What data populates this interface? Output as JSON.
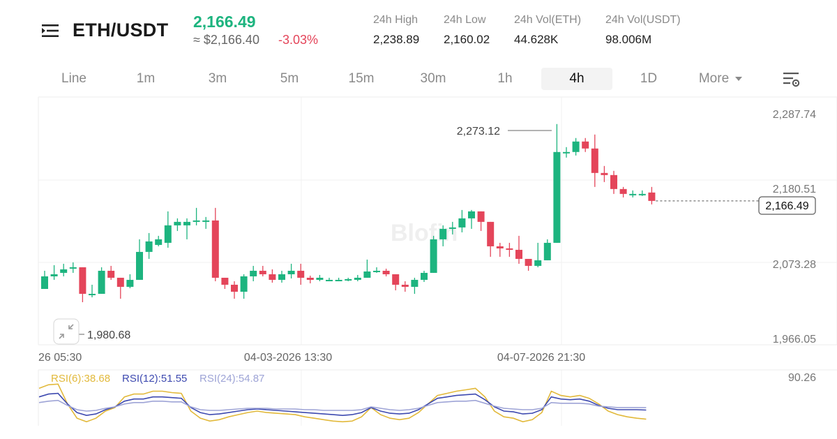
{
  "header": {
    "pair": "ETH/USDT",
    "last_price": "2,166.49",
    "approx_price": "≈ $2,166.40",
    "change": "-3.03%",
    "stats": [
      {
        "label": "24h High",
        "value": "2,238.89"
      },
      {
        "label": "24h Low",
        "value": "2,160.02"
      },
      {
        "label": "24h Vol(ETH)",
        "value": "44.628K"
      },
      {
        "label": "24h Vol(USDT)",
        "value": "98.006M"
      }
    ]
  },
  "tabs": [
    "Line",
    "1m",
    "3m",
    "5m",
    "15m",
    "30m",
    "1h",
    "4h",
    "1D",
    "More"
  ],
  "active_tab": "4h",
  "icons": {
    "menu": "menu-icon",
    "settings": "chart-settings-icon",
    "collapse": "collapse-arrows-icon"
  },
  "colors": {
    "up": "#1db47f",
    "down": "#e4455a",
    "rsi6": "#e2b93b",
    "rsi12": "#3e4ab0",
    "rsi24": "#9ea4d6"
  },
  "chart_data": [
    {
      "type": "candlestick",
      "y_axis_labels": [
        "2,287.74",
        "2,180.51",
        "2,073.28",
        "1,966.05"
      ],
      "y_axis_values": [
        2287.74,
        2180.51,
        2073.28,
        1966.05
      ],
      "x_axis_labels": [
        "26 05:30",
        "04-03-2026 13:30",
        "04-07-2026 21:30"
      ],
      "current_price_label": "2,166.49",
      "high_marker": "2,273.12",
      "low_marker": "1,980.68",
      "watermark": "Blofin",
      "candles": [
        [
          2037,
          2055,
          2063,
          2037
        ],
        [
          2055,
          2058,
          2071,
          2050
        ],
        [
          2060,
          2065,
          2073,
          2055
        ],
        [
          2068,
          2068,
          2075,
          2060
        ],
        [
          2068,
          2030,
          2068,
          2018
        ],
        [
          2030,
          2030,
          2043,
          2025
        ],
        [
          2030,
          2063,
          2068,
          2030
        ],
        [
          2063,
          2053,
          2070,
          2050
        ],
        [
          2053,
          2040,
          2053,
          2023
        ],
        [
          2040,
          2050,
          2058,
          2038
        ],
        [
          2050,
          2090,
          2108,
          2050
        ],
        [
          2090,
          2105,
          2117,
          2080
        ],
        [
          2100,
          2108,
          2113,
          2098
        ],
        [
          2103,
          2128,
          2148,
          2096
        ],
        [
          2128,
          2133,
          2138,
          2120
        ],
        [
          2128,
          2133,
          2138,
          2108
        ],
        [
          2133,
          2135,
          2153,
          2128
        ],
        [
          2135,
          2135,
          2140,
          2123
        ],
        [
          2135,
          2053,
          2153,
          2048
        ],
        [
          2053,
          2043,
          2053,
          2037
        ],
        [
          2043,
          2033,
          2048,
          2023
        ],
        [
          2033,
          2055,
          2058,
          2023
        ],
        [
          2055,
          2063,
          2070,
          2048
        ],
        [
          2063,
          2058,
          2070,
          2055
        ],
        [
          2058,
          2050,
          2065,
          2046
        ],
        [
          2050,
          2058,
          2063,
          2046
        ],
        [
          2058,
          2063,
          2073,
          2052
        ],
        [
          2063,
          2053,
          2073,
          2043
        ],
        [
          2053,
          2050,
          2056,
          2045
        ],
        [
          2050,
          2053,
          2057,
          2048
        ],
        [
          2050,
          2050,
          2053,
          2048
        ],
        [
          2050,
          2050,
          2053,
          2048
        ],
        [
          2050,
          2051,
          2053,
          2048
        ],
        [
          2050,
          2053,
          2057,
          2048
        ],
        [
          2053,
          2062,
          2079,
          2053
        ],
        [
          2062,
          2063,
          2068,
          2060
        ],
        [
          2063,
          2058,
          2066,
          2055
        ],
        [
          2058,
          2043,
          2058,
          2035
        ],
        [
          2043,
          2040,
          2048,
          2033
        ],
        [
          2040,
          2050,
          2053,
          2030
        ],
        [
          2050,
          2060,
          2063,
          2047
        ],
        [
          2060,
          2108,
          2113,
          2060
        ],
        [
          2108,
          2123,
          2128,
          2098
        ],
        [
          2123,
          2125,
          2133,
          2115
        ],
        [
          2125,
          2138,
          2150,
          2118
        ],
        [
          2138,
          2148,
          2150,
          2123
        ],
        [
          2148,
          2133,
          2148,
          2120
        ],
        [
          2133,
          2098,
          2133,
          2083
        ],
        [
          2098,
          2095,
          2103,
          2083
        ],
        [
          2095,
          2093,
          2103,
          2083
        ],
        [
          2093,
          2080,
          2113,
          2073
        ],
        [
          2080,
          2070,
          2078,
          2063
        ],
        [
          2070,
          2078,
          2103,
          2068
        ],
        [
          2078,
          2103,
          2108,
          2078
        ],
        [
          2103,
          2233,
          2273,
          2103
        ],
        [
          2233,
          2233,
          2240,
          2225
        ],
        [
          2233,
          2248,
          2253,
          2228
        ],
        [
          2248,
          2238,
          2253,
          2233
        ],
        [
          2238,
          2203,
          2258,
          2183
        ],
        [
          2203,
          2200,
          2213,
          2190
        ],
        [
          2200,
          2180,
          2206,
          2173
        ],
        [
          2180,
          2173,
          2183,
          2168
        ],
        [
          2173,
          2173,
          2178,
          2168
        ],
        [
          2173,
          2173,
          2178,
          2170
        ],
        [
          2175,
          2163,
          2183,
          2158
        ]
      ]
    },
    {
      "type": "line",
      "title": "RSI",
      "y_label": "90.26",
      "series": [
        {
          "name": "RSI(6)",
          "label": "RSI(6):38.68",
          "values": [
            82,
            87,
            88,
            60,
            40,
            35,
            40,
            50,
            55,
            70,
            74,
            74,
            78,
            78,
            76,
            75,
            50,
            40,
            36,
            38,
            42,
            45,
            48,
            50,
            48,
            47,
            46,
            45,
            42,
            40,
            38,
            36,
            35,
            36,
            42,
            55,
            45,
            40,
            38,
            40,
            48,
            60,
            72,
            75,
            78,
            80,
            82,
            70,
            50,
            42,
            40,
            35,
            38,
            48,
            78,
            72,
            70,
            72,
            68,
            60,
            50,
            45,
            42,
            40,
            38.68
          ]
        },
        {
          "name": "RSI(12)",
          "label": "RSI(12):51.55",
          "values": [
            70,
            74,
            75,
            60,
            48,
            44,
            46,
            52,
            56,
            64,
            67,
            67,
            70,
            70,
            69,
            68,
            55,
            48,
            45,
            46,
            48,
            50,
            52,
            53,
            52,
            51,
            50,
            49,
            48,
            47,
            46,
            45,
            44,
            45,
            48,
            55,
            50,
            47,
            46,
            47,
            52,
            60,
            68,
            70,
            72,
            73,
            74,
            66,
            56,
            50,
            49,
            46,
            47,
            52,
            70,
            67,
            66,
            67,
            64,
            58,
            54,
            52,
            52,
            52,
            51.55
          ]
        },
        {
          "name": "RSI(24)",
          "label": "RSI(24):54.87",
          "values": [
            62,
            64,
            65,
            58,
            52,
            50,
            51,
            54,
            56,
            60,
            62,
            62,
            64,
            64,
            63,
            63,
            56,
            52,
            51,
            51,
            52,
            53,
            54,
            54,
            54,
            53,
            53,
            53,
            52,
            52,
            51,
            51,
            51,
            51,
            52,
            56,
            54,
            52,
            51,
            52,
            54,
            58,
            62,
            63,
            64,
            64,
            65,
            61,
            57,
            54,
            53,
            52,
            52,
            54,
            62,
            61,
            61,
            61,
            60,
            57,
            56,
            55,
            55,
            55,
            54.87
          ]
        }
      ]
    }
  ]
}
